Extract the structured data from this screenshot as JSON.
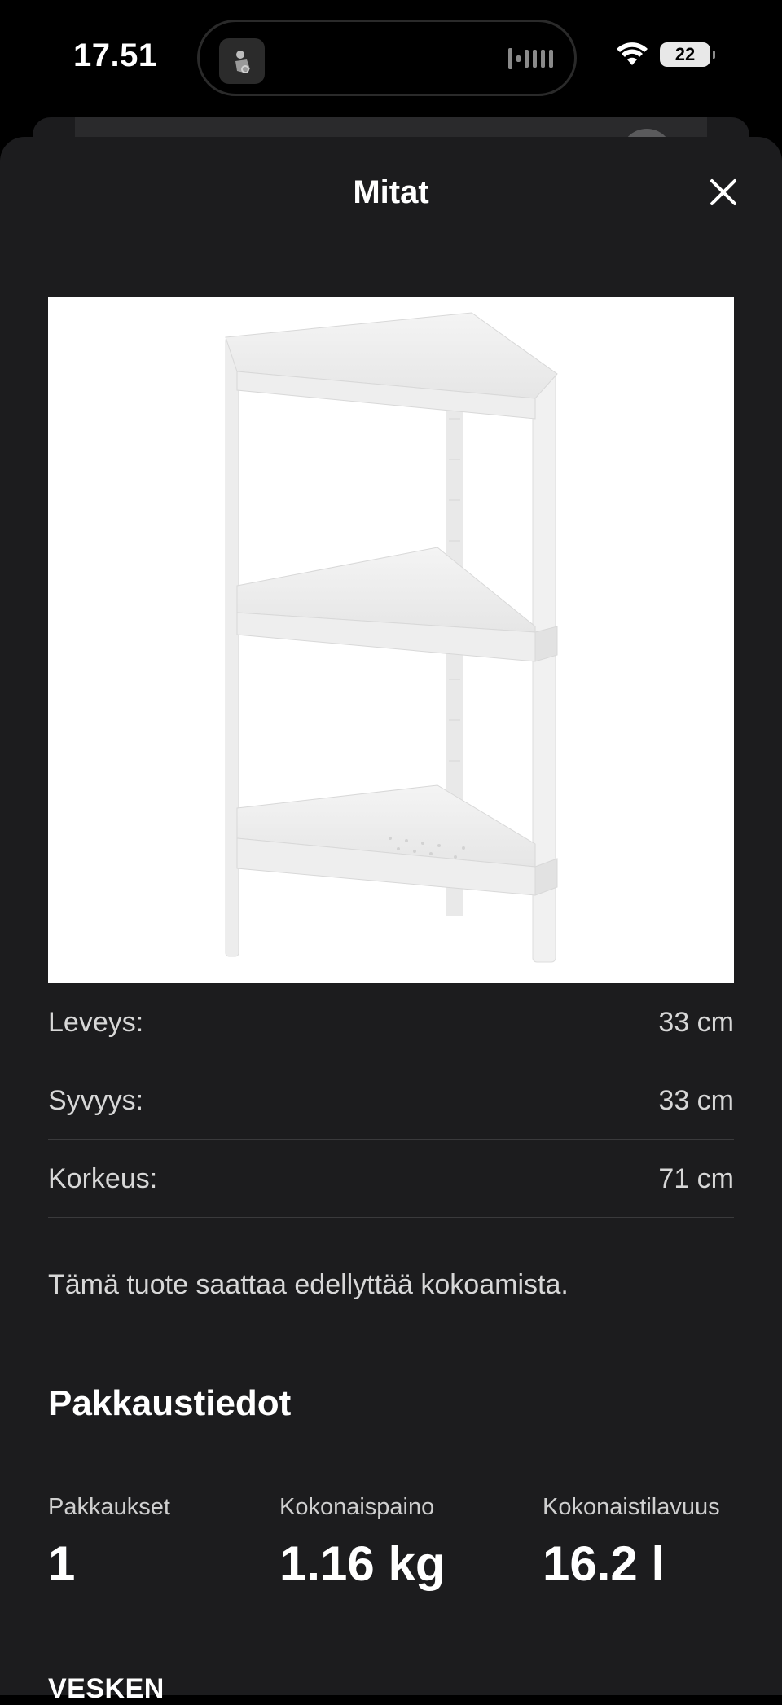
{
  "status_bar": {
    "time": "17.51",
    "battery": "22",
    "icons": [
      "album-art-icon",
      "audio-waveform-icon",
      "wifi-icon",
      "battery-icon"
    ]
  },
  "sheet": {
    "title": "Mitat",
    "close_icon": "close-icon",
    "image_alt": "corner-shelf-product-image"
  },
  "dimensions": [
    {
      "label": "Leveys:",
      "value": "33 cm"
    },
    {
      "label": "Syvyys:",
      "value": "33 cm"
    },
    {
      "label": "Korkeus:",
      "value": "71 cm"
    }
  ],
  "assembly_note": "Tämä tuote saattaa edellyttää kokoamista.",
  "packaging": {
    "heading": "Pakkaustiedot",
    "stats": [
      {
        "label": "Pakkaukset",
        "value": "1"
      },
      {
        "label": "Kokonaispaino",
        "value": "1.16 kg"
      },
      {
        "label": "Kokonaistilavuus",
        "value": "16.2 l"
      }
    ]
  },
  "product_name": "VESKEN",
  "colors": {
    "background": "#000000",
    "sheet": "#1c1c1e",
    "divider": "#3a3a3c",
    "text_primary": "#ffffff",
    "text_secondary": "#d7d7d7"
  }
}
